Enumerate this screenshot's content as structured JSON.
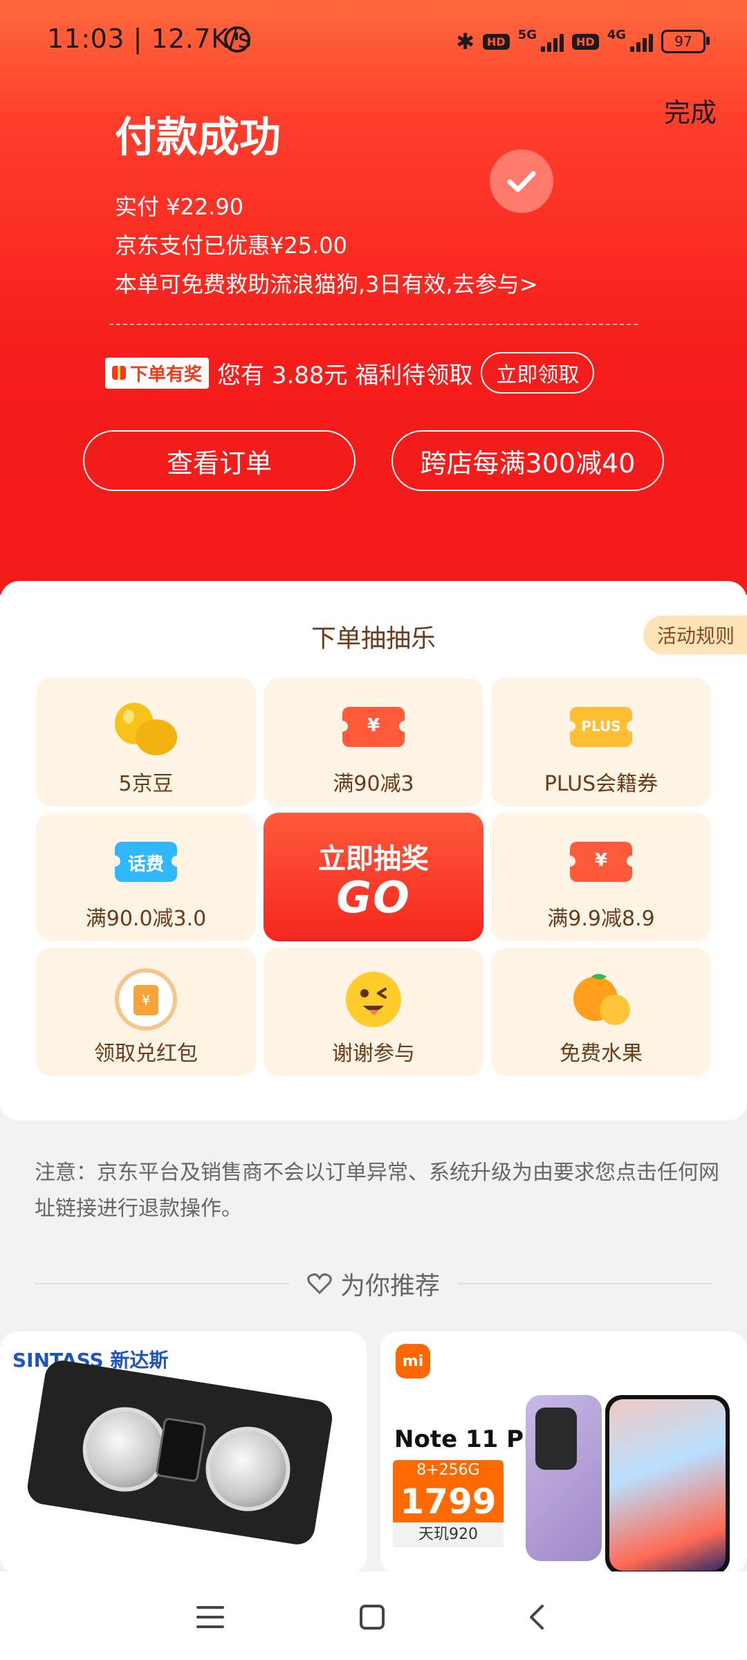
{
  "status_bar": {
    "time_speed": "11:03 | 12.7K/s",
    "bluetooth": "✱",
    "hd1": "HD",
    "net1": "5G",
    "hd2": "HD",
    "net2": "4G",
    "battery": "97"
  },
  "header": {
    "done": "完成",
    "title": "付款成功",
    "paid": "实付 ¥22.90",
    "discount": "京东支付已优惠¥25.00",
    "rescue": "本单可免费救助流浪猫狗,3日有效,去参与>",
    "badge": "下单有奖",
    "reward_text": "您有 3.88元 福利待领取",
    "claim": "立即领取",
    "view_order": "查看订单",
    "promo": "跨店每满300减40"
  },
  "lottery": {
    "title": "下单抽抽乐",
    "rules": "活动规则",
    "prizes": [
      {
        "label": "5京豆",
        "icon": "bean-icon"
      },
      {
        "label": "满90减3",
        "icon": "coupon-icon",
        "glyph": "¥"
      },
      {
        "label": "PLUS会籍券",
        "icon": "plus-coupon-icon",
        "glyph": "PLUS"
      },
      {
        "label": "满90.0减3.0",
        "icon": "phone-bill-icon",
        "glyph": "话费"
      },
      {
        "label": "满9.9减8.9",
        "icon": "coupon-icon",
        "glyph": "¥"
      },
      {
        "label": "领取兑红包",
        "icon": "redpacket-icon"
      },
      {
        "label": "谢谢参与",
        "icon": "emoji-icon"
      },
      {
        "label": "免费水果",
        "icon": "orange-icon"
      }
    ],
    "go_line1": "立即抽奖",
    "go_line2": "GO"
  },
  "notice": "注意：京东平台及销售商不会以订单异常、系统升级为由要求您点击任何网址链接进行退款操作。",
  "recommend": {
    "title": "为你推荐"
  },
  "products": [
    {
      "brand": "SINTASS 新达斯"
    },
    {
      "logo": "mi",
      "model": "Note 11 Pro",
      "spec": "8+256G",
      "price": "1799",
      "chip": "天玑920"
    }
  ],
  "colors": {
    "header_red": "#f51d1b",
    "tile_bg": "#fff4e5",
    "tile_text": "#6d3a17"
  }
}
